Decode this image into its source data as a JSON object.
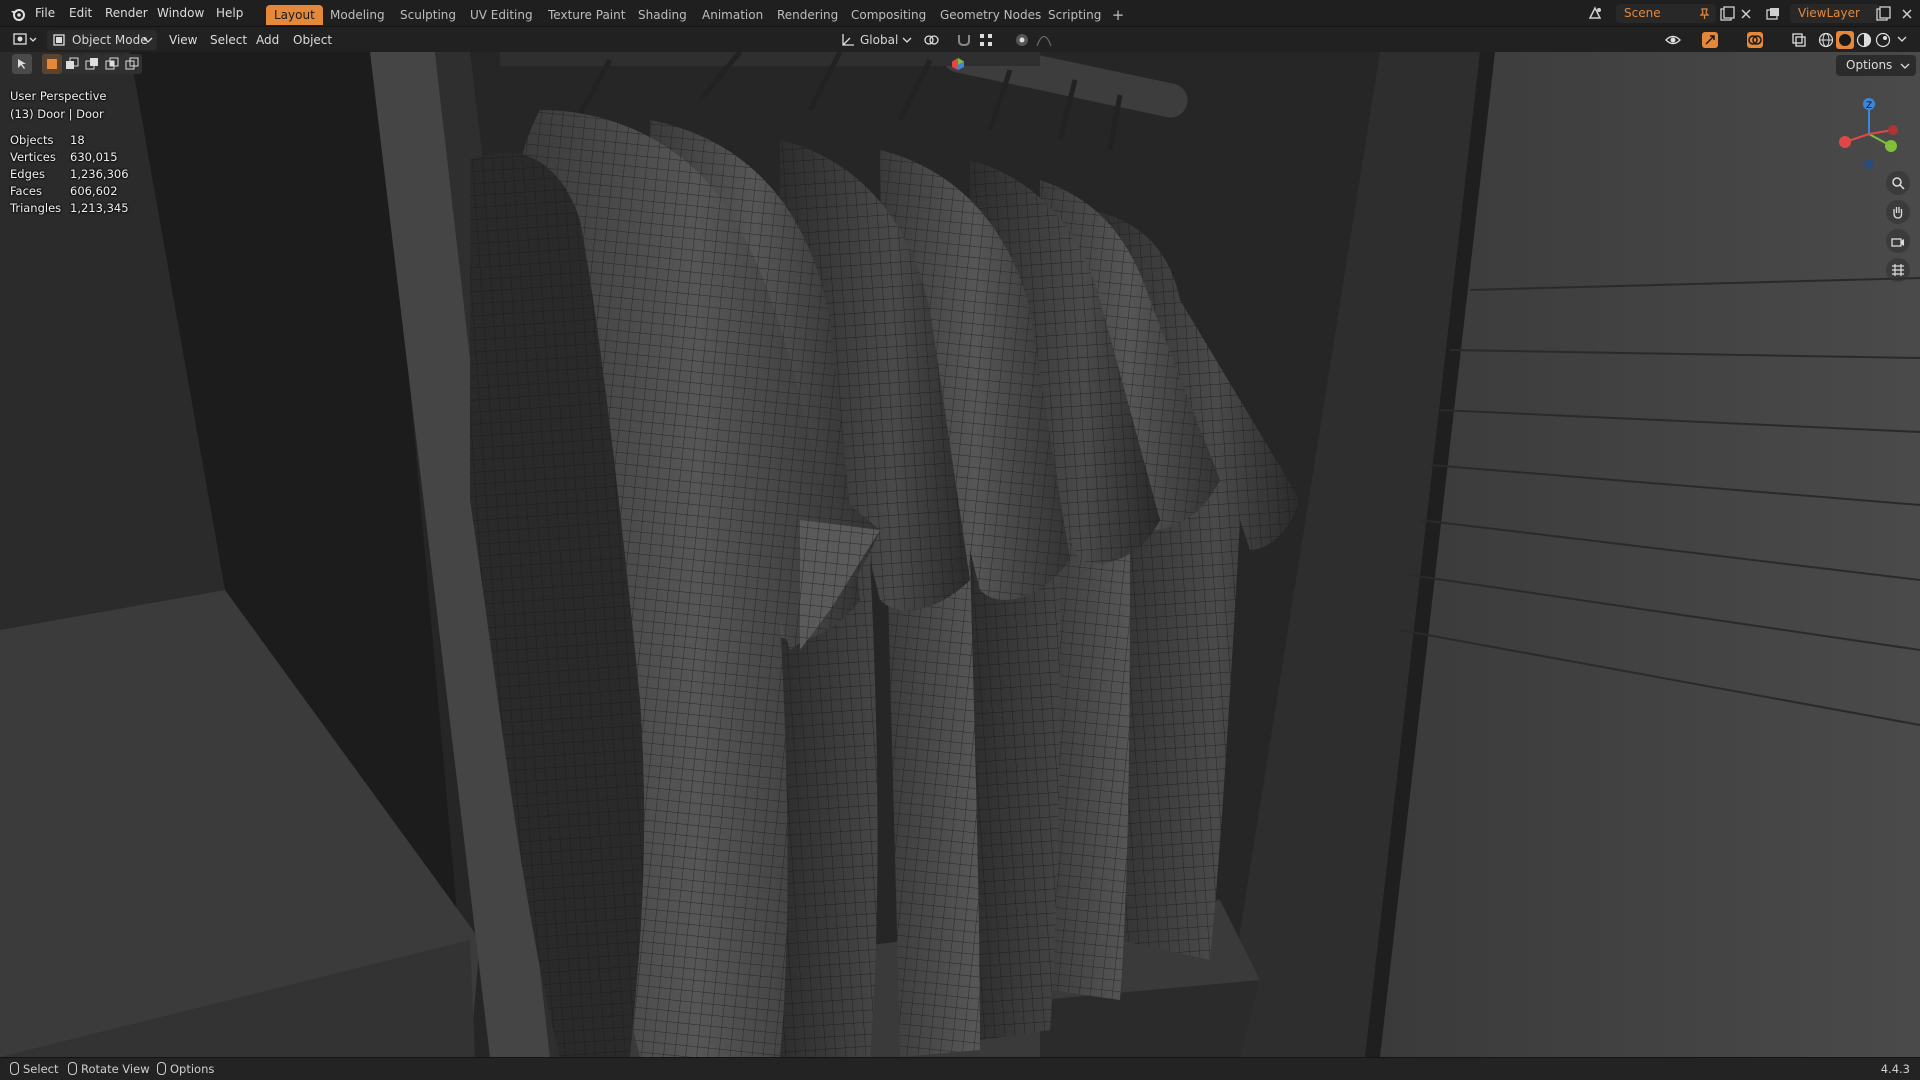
{
  "menu": {
    "items": [
      "File",
      "Edit",
      "Render",
      "Window",
      "Help"
    ]
  },
  "workspaces": {
    "tabs": [
      "Layout",
      "Modeling",
      "Sculpting",
      "UV Editing",
      "Texture Paint",
      "Shading",
      "Animation",
      "Rendering",
      "Compositing",
      "Geometry Nodes",
      "Scripting"
    ],
    "active": "Layout",
    "add_label": "+"
  },
  "scene": {
    "name": "Scene",
    "view_layer": "ViewLayer"
  },
  "header": {
    "mode": "Object Mode",
    "menus": [
      "View",
      "Select",
      "Add",
      "Object"
    ],
    "transform_orientation": "Global",
    "options_label": "Options"
  },
  "viewport_overlay": {
    "view_name": "User Perspective",
    "object_info": "(13) Door | Door",
    "stats": [
      {
        "label": "Objects",
        "value": "18"
      },
      {
        "label": "Vertices",
        "value": "630,015"
      },
      {
        "label": "Edges",
        "value": "1,236,306"
      },
      {
        "label": "Faces",
        "value": "606,602"
      },
      {
        "label": "Triangles",
        "value": "1,213,345"
      }
    ]
  },
  "gizmo": {
    "z_label": "Z"
  },
  "statusbar": {
    "items": [
      "Select",
      "Rotate View",
      "Options"
    ],
    "version": "4.4.3"
  },
  "colors": {
    "accent": "#e5883a",
    "axis_x": "#e04747",
    "axis_y": "#7fbf3a",
    "axis_z": "#3d86e0"
  }
}
